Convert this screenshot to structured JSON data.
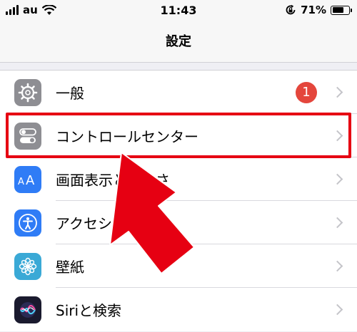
{
  "status_bar": {
    "carrier": "au",
    "time": "11:43",
    "battery_percent": "71%",
    "battery_level": 0.71,
    "icons": [
      "signal-icon",
      "wifi-icon",
      "orientation-lock-icon",
      "battery-icon"
    ]
  },
  "nav": {
    "title": "設定"
  },
  "settings": {
    "items": [
      {
        "label": "一般",
        "icon": "gear-icon",
        "icon_color": "#8e8e93",
        "badge": "1"
      },
      {
        "label": "コントロールセンター",
        "icon": "toggle-icon",
        "icon_color": "#8e8e93"
      },
      {
        "label": "画面表示と明るさ",
        "icon": "text-size-icon",
        "icon_color": "#2f7cf6"
      },
      {
        "label": "アクセシビリティ",
        "icon": "accessibility-icon",
        "icon_color": "#2f7cf6"
      },
      {
        "label": "壁紙",
        "icon": "flower-icon",
        "icon_color": "#3aa9d6"
      },
      {
        "label": "Siriと検索",
        "icon": "siri-icon",
        "icon_color": "#1a1a2e"
      }
    ]
  },
  "annotation": {
    "highlight_color": "#e60012",
    "highlighted_item": "コントロールセンター"
  }
}
